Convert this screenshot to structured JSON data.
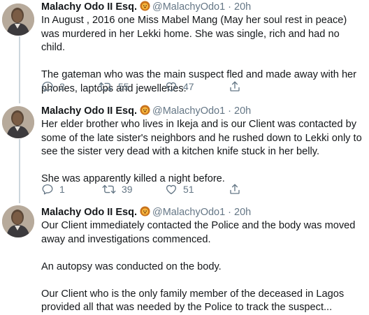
{
  "tweets": [
    {
      "author_name": "Malachy Odo II Esq.",
      "badge_icon": "lion-emoji-icon",
      "handle": "@MalachyOdo1",
      "separator": "·",
      "time": "20h",
      "paragraphs": [
        "In August , 2016 one Miss Mabel Mang (May her soul rest in peace) was murdered in her Lekki home. She was single, rich and had no child.",
        "The gateman who was the main suspect fled and made away with her phones, laptops and jewelleries."
      ],
      "replies": "2",
      "retweets": "55",
      "likes": "47"
    },
    {
      "author_name": "Malachy Odo II Esq.",
      "badge_icon": "lion-emoji-icon",
      "handle": "@MalachyOdo1",
      "separator": "·",
      "time": "20h",
      "paragraphs": [
        "Her elder brother who lives in Ikeja and is our Client was contacted by some of the late sister's neighbors and he rushed down to Lekki only to see the sister very dead with a kitchen knife stuck in her belly.",
        "She was apparently killed a night before."
      ],
      "replies": "1",
      "retweets": "39",
      "likes": "51"
    },
    {
      "author_name": "Malachy Odo II Esq.",
      "badge_icon": "lion-emoji-icon",
      "handle": "@MalachyOdo1",
      "separator": "·",
      "time": "20h",
      "paragraphs": [
        "Our Client immediately contacted the Police and the body was moved away and investigations commenced.",
        "An autopsy was conducted on the body.",
        "Our Client who is the only family member of the deceased in Lagos provided all that was needed by the Police to track the suspect..."
      ]
    }
  ],
  "icons": {
    "reply": "reply-icon",
    "retweet": "retweet-icon",
    "like": "heart-icon",
    "share": "share-icon"
  },
  "colors": {
    "text": "#14171a",
    "secondary": "#657786",
    "thread_line": "#ccd6dd",
    "divider": "#e6ecf0"
  }
}
